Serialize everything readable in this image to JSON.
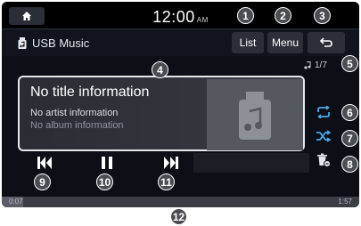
{
  "status_bar": {
    "time": "12:00",
    "ampm": "AM"
  },
  "header": {
    "source_label": "USB Music",
    "list_label": "List",
    "menu_label": "Menu"
  },
  "track": {
    "title": "No title information",
    "artist": "No artist information",
    "album": "No album information",
    "counter": "1/7",
    "elapsed": "0:07",
    "total": "1:57",
    "progress_fraction": 0.06
  },
  "callouts": [
    "1",
    "2",
    "3",
    "4",
    "5",
    "6",
    "7",
    "8",
    "9",
    "10",
    "11",
    "12"
  ],
  "icons": {
    "home": "home-icon",
    "usb": "usb-music-icon",
    "back": "back-arrow-icon",
    "note": "music-note-icon",
    "repeat": "repeat-icon",
    "shuffle": "shuffle-icon",
    "delete": "delete-icon",
    "prev": "skip-previous-icon",
    "pause": "pause-icon",
    "next": "skip-next-icon"
  },
  "colors": {
    "accent": "#4aa8e8",
    "panel_border": "#e5e7ea",
    "screen_bg": "#0c0f16"
  }
}
